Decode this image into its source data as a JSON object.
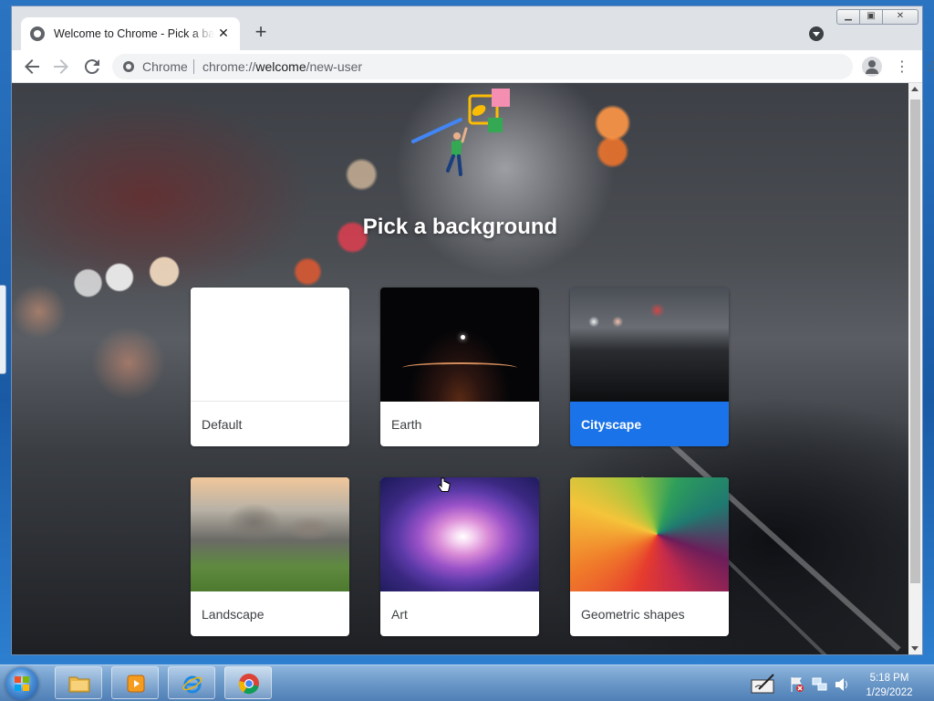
{
  "browser": {
    "tab_title": "Welcome to Chrome - Pick a background",
    "tab_close": "✕",
    "new_tab": "+",
    "omnibox": {
      "chip_label": "Chrome",
      "url_prefix": "chrome://",
      "url_host": "welcome",
      "url_path": "/new-user"
    },
    "icons": {
      "back": "back-arrow-icon",
      "forward": "forward-arrow-icon",
      "reload": "reload-icon",
      "star": "bookmark-star-icon",
      "profile": "profile-icon",
      "menu": "kebab-menu-icon"
    }
  },
  "page": {
    "heading": "Pick a background",
    "cards": [
      {
        "label": "Default",
        "selected": false
      },
      {
        "label": "Earth",
        "selected": false
      },
      {
        "label": "Cityscape",
        "selected": true
      },
      {
        "label": "Landscape",
        "selected": false
      },
      {
        "label": "Art",
        "selected": false
      },
      {
        "label": "Geometric shapes",
        "selected": false
      }
    ],
    "selected_color": "#1a73e8"
  },
  "taskbar": {
    "apps": [
      "file-explorer",
      "media-player",
      "internet-explorer",
      "chrome"
    ],
    "active_app": "chrome",
    "time": "5:18 PM",
    "date": "1/29/2022"
  }
}
